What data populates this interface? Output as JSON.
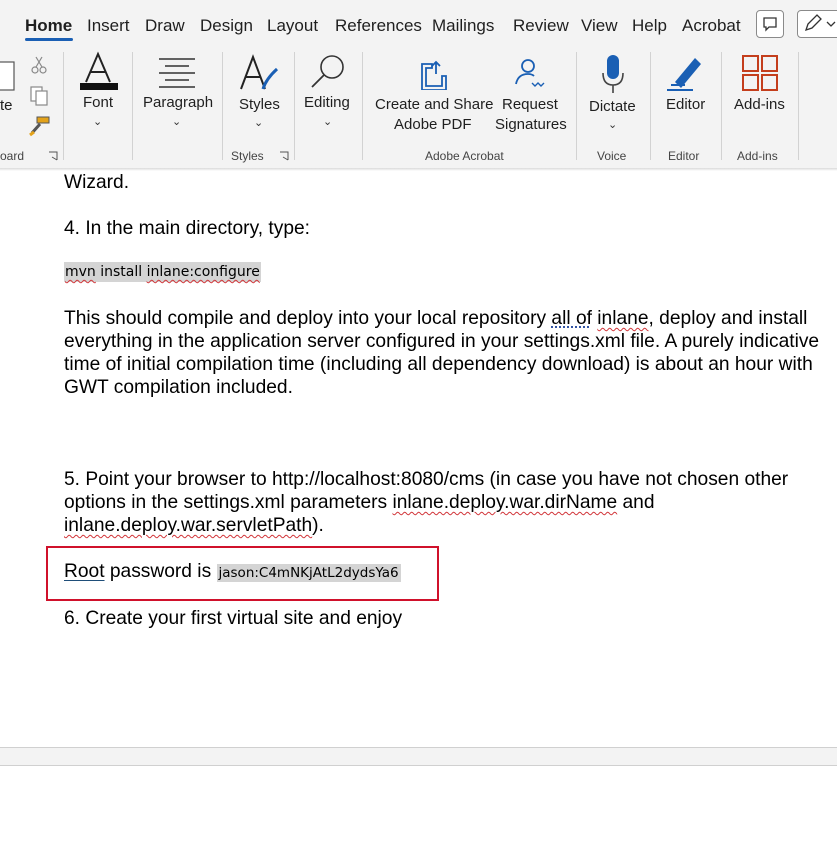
{
  "tabs": [
    "Home",
    "Insert",
    "Draw",
    "Design",
    "Layout",
    "References",
    "Mailings",
    "Review",
    "View",
    "Help",
    "Acrobat"
  ],
  "ribbon": {
    "paste_partial": "te",
    "clipboard_partial": "oard",
    "font": "Font",
    "paragraph": "Paragraph",
    "styles": "Styles",
    "styles_group": "Styles",
    "editing": "Editing",
    "create_share_line1": "Create and Share",
    "create_share_line2": "Adobe PDF",
    "request_line1": "Request",
    "request_line2": "Signatures",
    "adobe_group": "Adobe Acrobat",
    "dictate": "Dictate",
    "voice_group": "Voice",
    "editor": "Editor",
    "editor_group": "Editor",
    "addins": "Add-ins",
    "addins_group": "Add-ins"
  },
  "doc": {
    "wizard": "Wizard.",
    "step4": "4. In the main directory, type:",
    "cmd_a": "mvn",
    "cmd_b": " install ",
    "cmd_c": "inlane:configure",
    "p1_l1a": "This should compile and deploy into your local repository ",
    "p1_l1b": "all of",
    "p1_l1c": " ",
    "p1_l1d": "inlane",
    "p1_l1e": ", deploy and install",
    "p1_l2": "everything in the application server configured in your settings.xml file. A purely indicative",
    "p1_l3": "time of initial compilation time (including all dependency download) is about an hour with",
    "p1_l4": "GWT compilation included.",
    "step5_l1": "5. Point your browser to http://localhost:8080/cms (in case you have not chosen other",
    "step5_l2a": "options in the settings.xml parameters ",
    "step5_l2b": "inlane.deploy.war.dirName",
    "step5_l2c": " and",
    "step5_l3a": "inlane.deploy.war.servletPath",
    "step5_l3b": ").",
    "root_word": "Root",
    "pw_label": " password is ",
    "pw_value": "jason:C4mNKjAtL2dydsYa6",
    "step6": "6. Create your first virtual site and enjoy"
  },
  "colors": {
    "accent": "#1a5fb4",
    "adobe_red": "#c43e1c",
    "highlight_border": "#d0112b"
  }
}
